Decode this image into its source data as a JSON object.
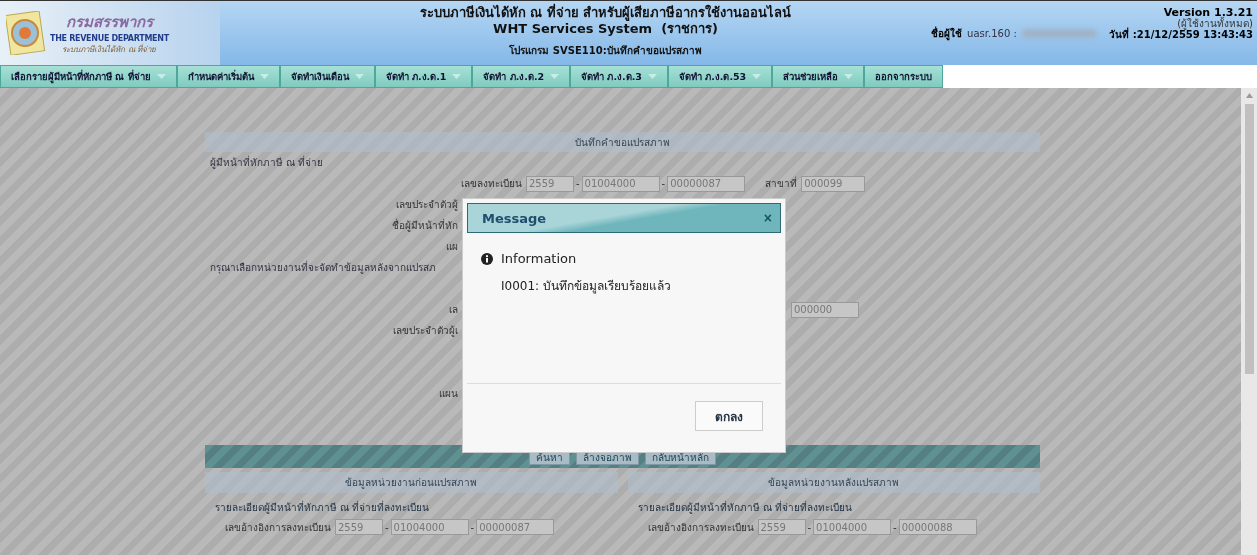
{
  "header": {
    "logo_title": "กรมสรรพากร",
    "logo_subtitle": "THE REVENUE DEPARTMENT",
    "logo_caption": "ระบบภาษีเงินได้หัก ณ ที่จ่าย",
    "title_lines": [
      "ระบบภาษีเงินได้หัก ณ ที่จ่าย สำหรับผู้เสียภาษีอากรใช้งานออนไลน์",
      "WHT Services System  (ราชการ)"
    ],
    "program": "โปรแกรม SVSE110:บันทึกคำขอแปรสภาพ",
    "user_label": "ชื่อผู้ใช้",
    "user_value": "uasr.160 :",
    "version": "Version 1.3.21",
    "user_scope": "(ผู้ใช้งานทั้งหมด)",
    "date_label": "วันที่",
    "date_value": ":21/12/2559 13:43:43"
  },
  "menu": [
    {
      "label": "เลือกรายผู้มีหน้าที่หักภาษี ณ ที่จ่าย",
      "has_dropdown": true
    },
    {
      "label": "กำหนดค่าเริ่มต้น",
      "has_dropdown": true
    },
    {
      "label": "จัดทำเงินเดือน",
      "has_dropdown": true
    },
    {
      "label": "จัดทำ ภ.ง.ด.1",
      "has_dropdown": true
    },
    {
      "label": "จัดทำ ภ.ง.ด.2",
      "has_dropdown": true
    },
    {
      "label": "จัดทำ ภ.ง.ด.3",
      "has_dropdown": true
    },
    {
      "label": "จัดทำ ภ.ง.ด.53",
      "has_dropdown": true
    },
    {
      "label": "ส่วนช่วยเหลือ",
      "has_dropdown": true
    },
    {
      "label": "ออกจากระบบ",
      "has_dropdown": false
    }
  ],
  "form": {
    "title": "บันทึกคำขอแปรสภาพ",
    "rows": [
      {
        "kind": "heading",
        "text": "ผู้มีหน้าที่หักภาษี ณ ที่จ่าย"
      },
      {
        "kind": "registration",
        "label": "เลขลงทะเบียน",
        "fields": [
          "2559",
          "01004000",
          "00000087"
        ],
        "separator": "-",
        "branch_label": "สาขาที่",
        "branch_value": "000099"
      },
      {
        "kind": "cut",
        "text": "เลขประจำตัวผู้"
      },
      {
        "kind": "cut",
        "text": "ชื่อผู้มีหน้าที่หัก"
      },
      {
        "kind": "cut",
        "text": "แผ"
      },
      {
        "kind": "heading",
        "text": "กรุณาเลือกหน่วยงานที่จะจัดทำข้อมูลหลังจากแปรสภ"
      },
      {
        "kind": "spacer"
      },
      {
        "kind": "cut_field",
        "text": "เล",
        "value": "000000"
      },
      {
        "kind": "cut",
        "text": "เลขประจำตัวผู้เ"
      },
      {
        "kind": "spacer"
      },
      {
        "kind": "spacer"
      },
      {
        "kind": "cut",
        "text": "แผน"
      },
      {
        "kind": "spacer"
      }
    ],
    "buttons": [
      "ค้นหา",
      "ล้างจอภาพ",
      "กลับหน้าหลัก"
    ],
    "columns": [
      {
        "title": "ข้อมูลหน่วยงานก่อนแปรสภาพ",
        "detail": "รายละเอียดผู้มีหน้าที่หักภาษี ณ ที่จ่ายที่ลงทะเบียน",
        "ref_label": "เลขอ้างอิงการลงทะเบียน",
        "ref_fields": [
          "2559",
          "01004000",
          "00000087"
        ]
      },
      {
        "title": "ข้อมูลหน่วยงานหลังแปรสภาพ",
        "detail": "รายละเอียดผู้มีหน้าที่หักภาษี ณ ที่จ่ายที่ลงทะเบียน",
        "ref_label": "เลขอ้างอิงการลงทะเบียน",
        "ref_fields": [
          "2559",
          "01004000",
          "00000088"
        ]
      }
    ]
  },
  "dialog": {
    "title": "Message",
    "close": "×",
    "heading": "Information",
    "message": "I0001: บันทึกข้อมูลเรียบร้อยแล้ว",
    "button": "ตกลง"
  }
}
